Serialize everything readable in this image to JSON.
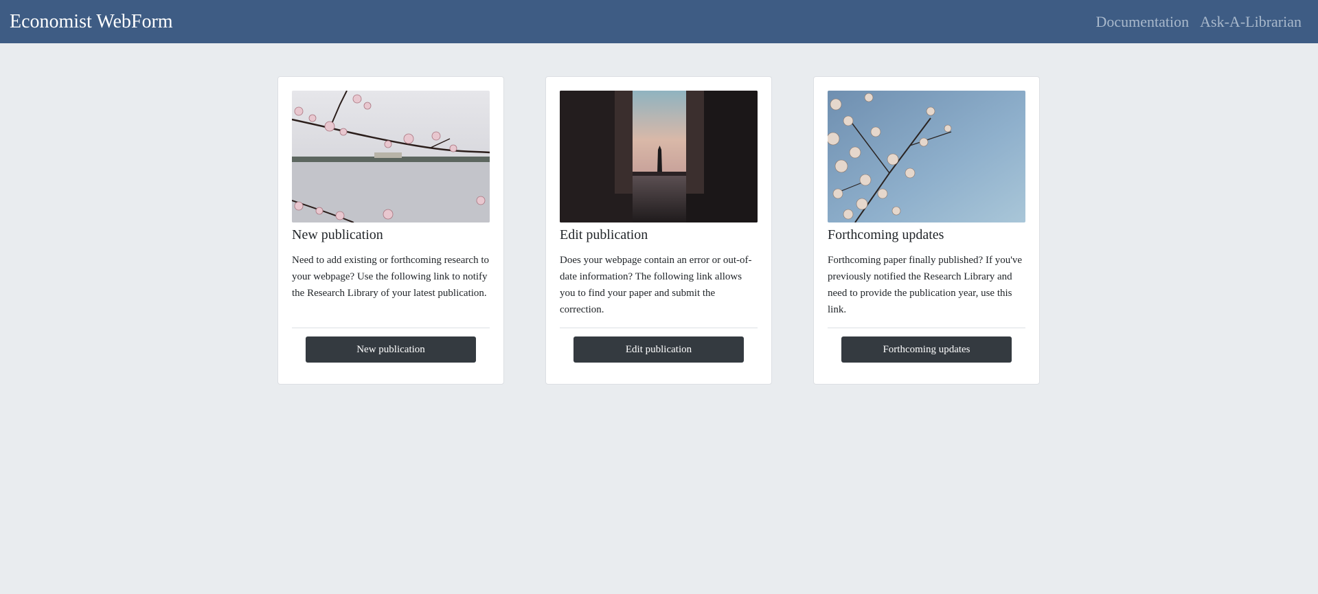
{
  "header": {
    "brand": "Economist WebForm",
    "links": [
      "Documentation",
      "Ask-A-Librarian"
    ]
  },
  "cards": [
    {
      "image": "cherry-blossoms-over-water-photo",
      "title": "New publication",
      "text": "Need to add existing or forthcoming research to your webpage? Use the following link to notify the Research Library of your latest publication.",
      "button": "New publication"
    },
    {
      "image": "monument-between-columns-photo",
      "title": "Edit publication",
      "text": "Does your webpage contain an error or out-of-date information? The following link allows you to find your paper and submit the correction.",
      "button": "Edit publication"
    },
    {
      "image": "cherry-blossoms-sky-photo",
      "title": "Forthcoming updates",
      "text": "Forthcoming paper finally published? If you've previously notified the Research Library and need to provide the publication year, use this link.",
      "button": "Forthcoming updates"
    }
  ],
  "colors": {
    "navbar": "#3e5c84",
    "background": "#e9ecef",
    "button": "#343a40"
  }
}
